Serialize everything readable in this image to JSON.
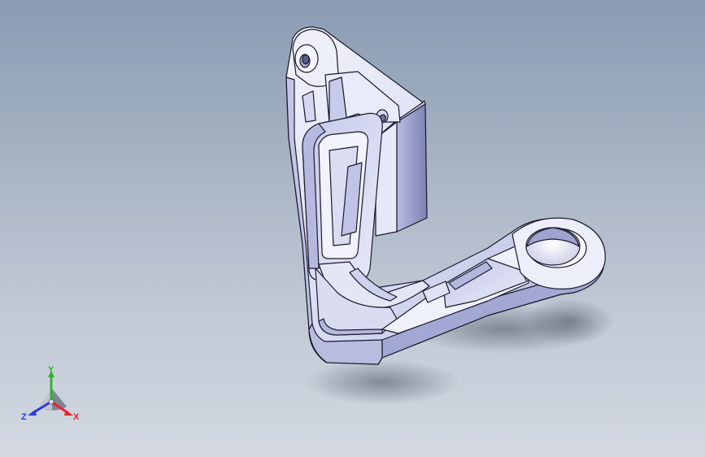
{
  "viewport": {
    "background_top": "#8a9bb2",
    "background_bottom": "#d3d8e1"
  },
  "part": {
    "name": "",
    "face_color": "#dcdff5",
    "shade_color": "#8f93c4",
    "edge_color": "#1a1a2a"
  },
  "triad": {
    "x_label": "X",
    "y_label": "Y",
    "z_label": "Z",
    "x_color": "#e8222a",
    "y_color": "#2fb52c",
    "z_color": "#2a3bd8"
  }
}
